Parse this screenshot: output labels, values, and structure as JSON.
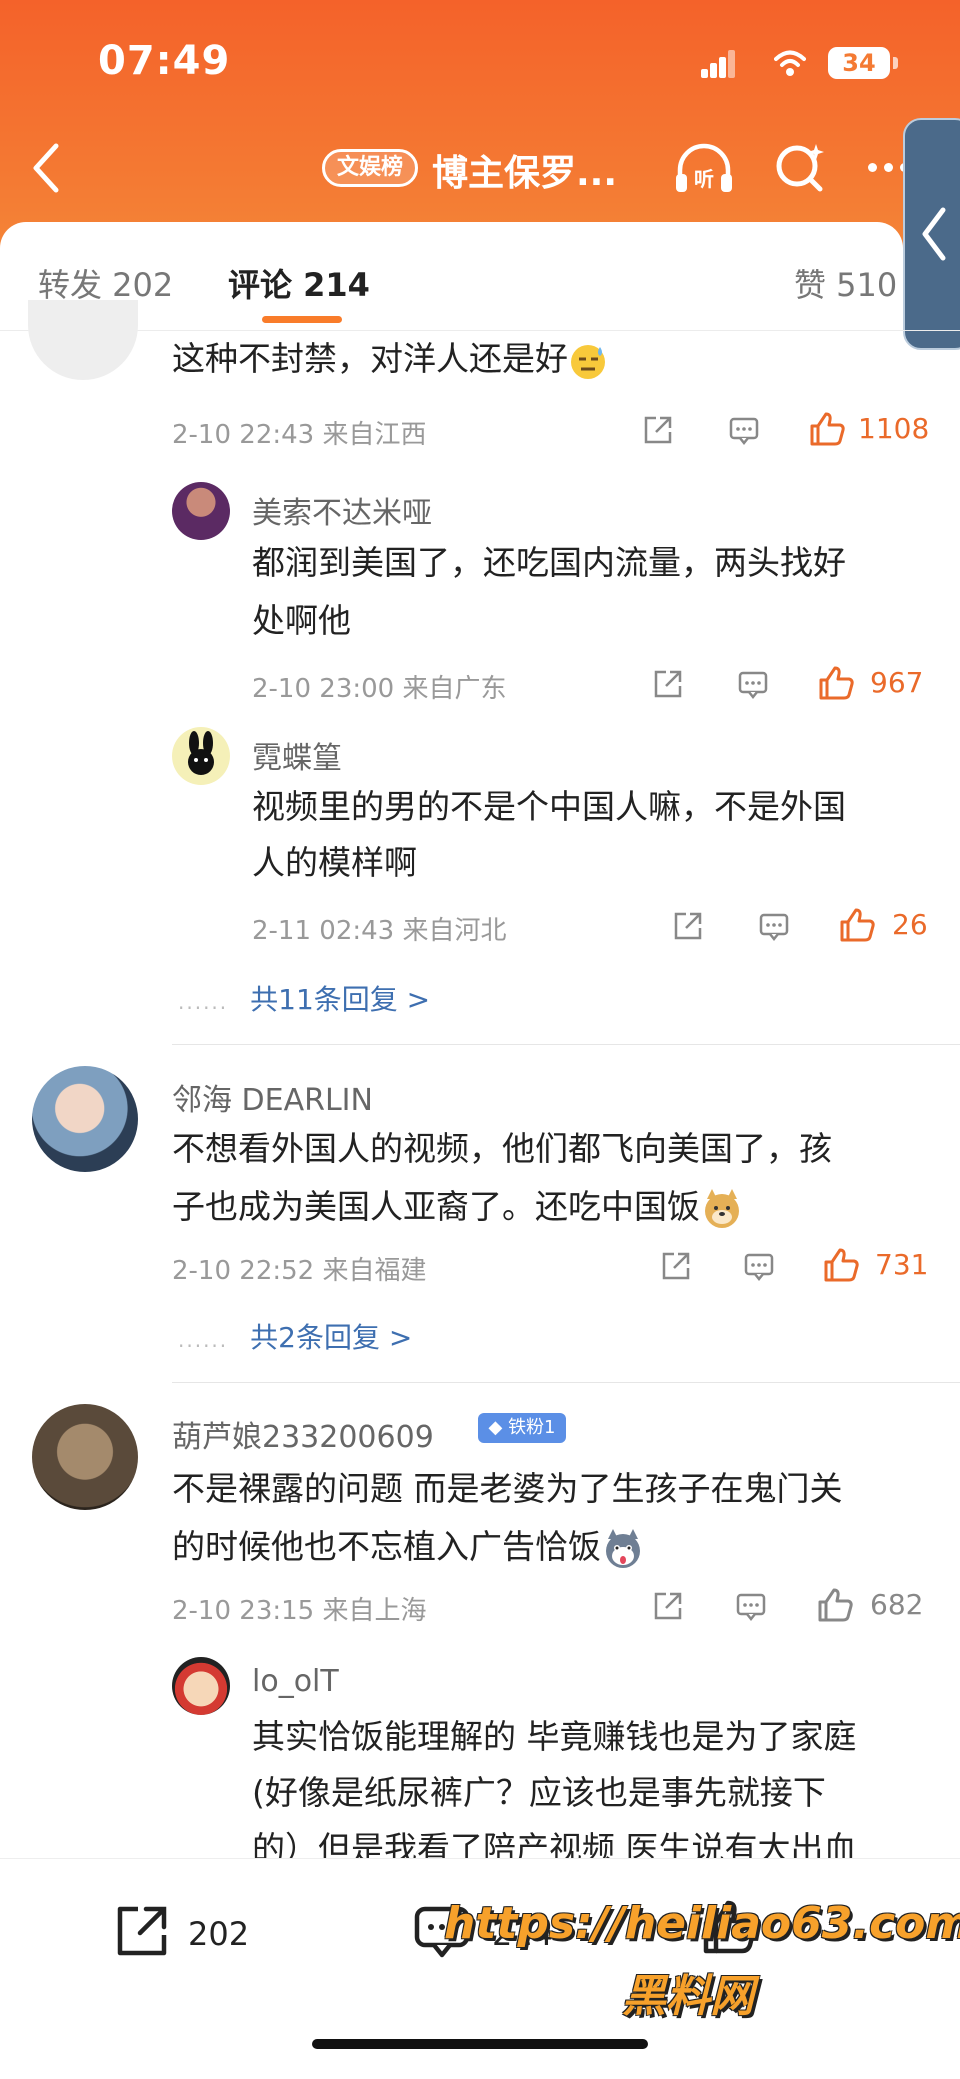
{
  "status": {
    "time": "07:49",
    "battery": "34"
  },
  "header": {
    "tag": "文娱榜",
    "title": "博主保罗...",
    "listen_label": "听"
  },
  "tabs": [
    {
      "label": "转发 202"
    },
    {
      "label": "评论 214"
    },
    {
      "label": "赞 510"
    }
  ],
  "comments": [
    {
      "text_lines": [
        "这种不封禁，对洋人还是好"
      ],
      "meta": "2-10 22:43 来自江西",
      "likes": "1108",
      "replies": [
        {
          "user": "美索不达米哑",
          "text_lines": [
            "都润到美国了，还吃国内流量，两头找好",
            "处啊他"
          ],
          "meta": "2-10 23:00 来自广东",
          "likes": "967"
        },
        {
          "user": "霓蝶篁",
          "text_lines": [
            "视频里的男的不是个中国人嘛，不是外国",
            "人的模样啊"
          ],
          "meta": "2-11 02:43 来自河北",
          "likes": "26"
        }
      ],
      "more_replies": "共11条回复 >"
    },
    {
      "user": "邻海 DEARLIN",
      "text_lines": [
        "不想看外国人的视频，他们都飞向美国了，孩",
        "子也成为美国人亚裔了。还吃中国饭"
      ],
      "meta": "2-10 22:52 来自福建",
      "likes": "731",
      "more_replies": "共2条回复 >"
    },
    {
      "user": "葫芦娘233200609",
      "badge": "铁粉1",
      "text_lines": [
        "不是裸露的问题 而是老婆为了生孩子在鬼门关",
        "的时候他也不忘植入广告恰饭"
      ],
      "meta": "2-10 23:15 来自上海",
      "likes": "682",
      "replies": [
        {
          "user": "lo_olT",
          "text_lines": [
            "其实恰饭能理解的 毕竟赚钱也是为了家庭",
            "(好像是纸尿裤广？应该也是事先就接下",
            "的）但是我看了陪产视频 医生说有大出血"
          ]
        }
      ]
    }
  ],
  "bottom_bar": {
    "repost_count": "202",
    "comment_count": "214"
  },
  "watermark": {
    "line1": "https://heiliao63.com",
    "line2": "黑料网"
  },
  "colors": {
    "header": "#f47a33",
    "accent": "#ea6a2a",
    "link": "#3e6fb0"
  }
}
